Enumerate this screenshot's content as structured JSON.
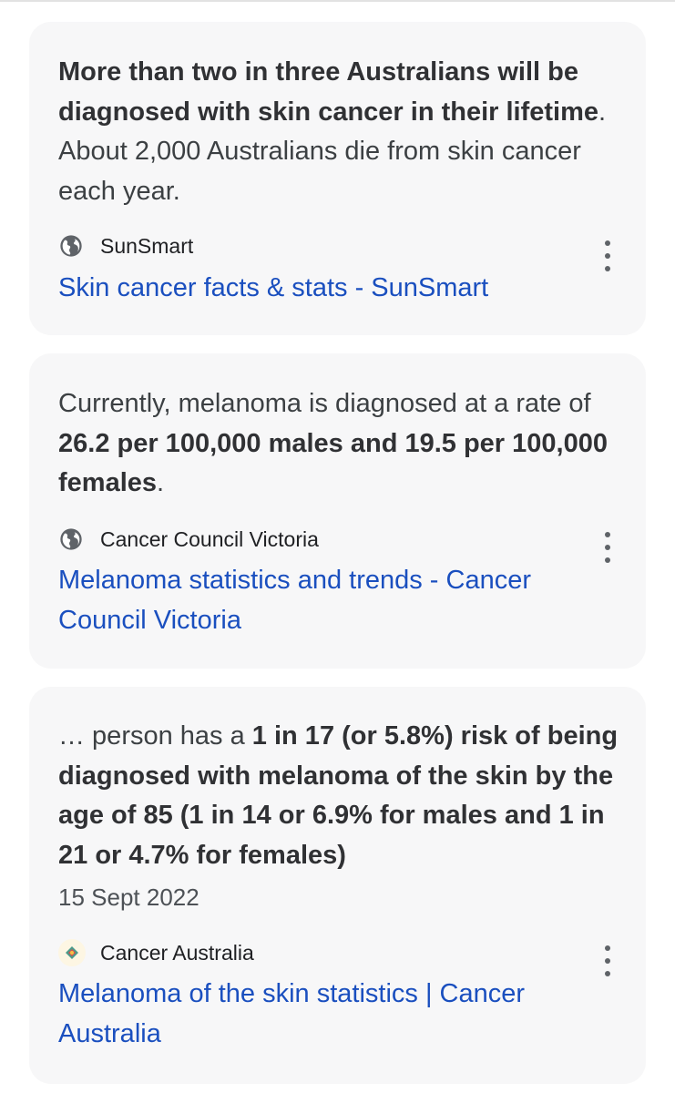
{
  "results": [
    {
      "snippet_bold": "More than two in three Australians will be diagnosed with skin cancer in their lifetime",
      "snippet_after": ". About 2,000 Australians die from skin cancer each year.",
      "source": "SunSmart",
      "link": "Skin cancer facts & stats - SunSmart",
      "icon": "globe-icon"
    },
    {
      "snippet_before": "Currently, melanoma is diagnosed at a rate of ",
      "snippet_bold": "26.2 per 100,000 males and 19.5 per 100,000 females",
      "snippet_after": ".",
      "source": "Cancer Council Victoria",
      "link": "Melanoma statistics and trends - Cancer Council Victoria",
      "icon": "globe-icon"
    },
    {
      "snippet_before": "… person has a ",
      "snippet_bold": "1 in 17 (or 5.8%) risk of being diagnosed with melanoma of the skin by the age of 85 (1 in 14 or 6.9% for males and 1 in 21 or 4.7% for females)",
      "date": "15 Sept 2022",
      "source": "Cancer Australia",
      "link": "Melanoma of the skin statistics | Cancer Australia",
      "icon": "cancer-australia-logo"
    }
  ],
  "colors": {
    "card_bg": "#f7f7f8",
    "link": "#1a4fbf",
    "text": "#3c4043"
  }
}
